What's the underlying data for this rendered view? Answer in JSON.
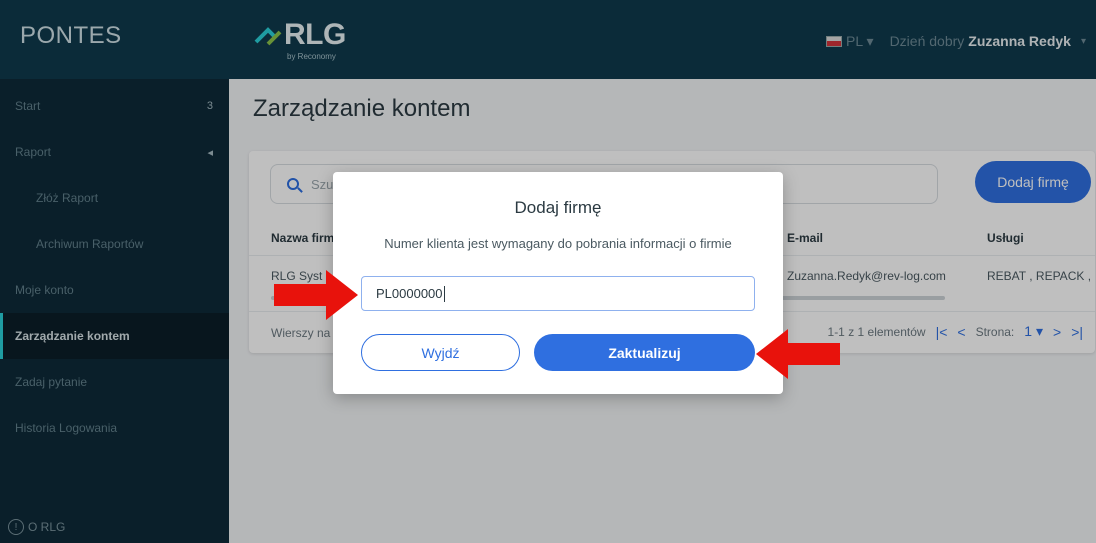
{
  "topbar": {
    "brand": "PONTES",
    "logo_text": "RLG",
    "logo_sub": "by Reconomy",
    "lang": "PL ▾",
    "greeting": "Dzień dobry",
    "user": "Zuzanna Redyk",
    "caret": "▾"
  },
  "sidebar": {
    "items": [
      {
        "label": "Start",
        "badge": "3"
      },
      {
        "label": "Raport",
        "badge": "◂"
      },
      {
        "label": "Złóż Raport"
      },
      {
        "label": "Archiwum Raportów"
      },
      {
        "label": "Moje konto"
      },
      {
        "label": "Zarządzanie kontem"
      },
      {
        "label": "Zadaj pytanie"
      },
      {
        "label": "Historia Logowania"
      }
    ],
    "footer": "O RLG",
    "footer_icon": "!"
  },
  "main": {
    "title": "Zarządzanie kontem",
    "search_placeholder": "Szu",
    "add_button": "Dodaj firmę",
    "columns": [
      "Nazwa firm",
      "E-mail",
      "Usługi"
    ],
    "row": [
      "RLG Syst",
      "Zuzanna.Redyk@rev-log.com",
      "REBAT , REPACK ,"
    ],
    "rows_per_page": "Wierszy na",
    "range": "1-1 z 1 elementów",
    "page_label": "Strona:",
    "page_value": "1",
    "page_caret": "▾",
    "pager_first": "|<",
    "pager_prev": "<",
    "pager_next": ">",
    "pager_last": ">|"
  },
  "modal": {
    "title": "Dodaj firmę",
    "subtitle": "Numer klienta jest wymagany do pobrania informacji o firmie",
    "input_value": "PL0000000",
    "exit_button": "Wyjdź",
    "update_button": "Zaktualizuj"
  },
  "colors": {
    "topbar": "#0f3a4d",
    "sidebar": "#0e2a38",
    "accent": "#2f6fe0",
    "arrow": "#e8120c"
  },
  "icons": [
    "search-icon",
    "info-icon",
    "flag-pl-icon",
    "logo-mark-icon",
    "arrow-right-annotation",
    "arrow-left-annotation"
  ]
}
